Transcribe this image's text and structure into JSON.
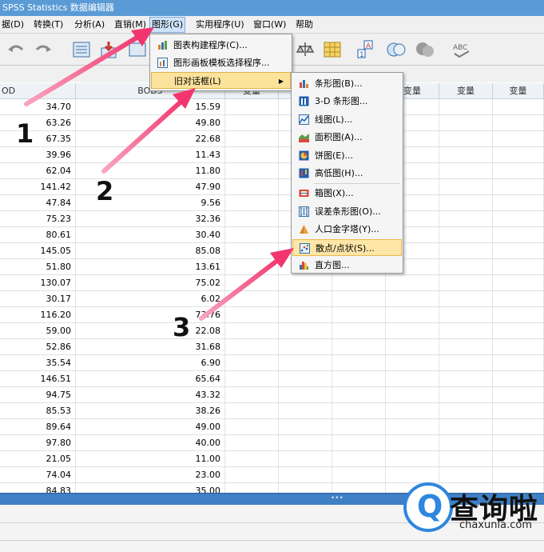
{
  "window": {
    "title": "SPSS Statistics 数据编辑器"
  },
  "menubar": [
    {
      "id": "data",
      "label": "据(D)"
    },
    {
      "id": "transform",
      "label": "转换(T)"
    },
    {
      "id": "analyze",
      "label": "分析(A)"
    },
    {
      "id": "direct",
      "label": "直销(M)"
    },
    {
      "id": "graphs",
      "label": "图形(G)"
    },
    {
      "id": "utilities",
      "label": "实用程序(U)"
    },
    {
      "id": "window",
      "label": "窗口(W)"
    },
    {
      "id": "help",
      "label": "帮助"
    }
  ],
  "grid": {
    "columns": [
      "OD",
      "BOD5",
      "变量",
      "变量",
      "变量",
      "变量",
      "变量",
      "变量"
    ],
    "rows": [
      [
        "34.70",
        "15.59"
      ],
      [
        "63.26",
        "49.80"
      ],
      [
        "67.35",
        "22.68"
      ],
      [
        "39.96",
        "11.43"
      ],
      [
        "62.04",
        "11.80"
      ],
      [
        "141.42",
        "47.90"
      ],
      [
        "47.84",
        "9.56"
      ],
      [
        "75.23",
        "32.36"
      ],
      [
        "80.61",
        "30.40"
      ],
      [
        "145.05",
        "85.08"
      ],
      [
        "51.80",
        "13.61"
      ],
      [
        "130.07",
        "75.02"
      ],
      [
        "30.17",
        "6.02"
      ],
      [
        "116.20",
        "73.76"
      ],
      [
        "59.00",
        "22.08"
      ],
      [
        "52.86",
        "31.68"
      ],
      [
        "35.54",
        "6.90"
      ],
      [
        "146.51",
        "65.64"
      ],
      [
        "94.75",
        "43.32"
      ],
      [
        "85.53",
        "38.26"
      ],
      [
        "89.64",
        "49.00"
      ],
      [
        "97.80",
        "40.00"
      ],
      [
        "21.05",
        "11.00"
      ],
      [
        "74.04",
        "23.00"
      ],
      [
        "84.83",
        "35.00"
      ]
    ]
  },
  "graphs_menu": [
    {
      "label": "图表构建程序(C)...",
      "icon": "chart-builder-icon"
    },
    {
      "label": "图形画板模板选择程序...",
      "icon": "graphboard-icon"
    },
    {
      "label": "旧对话框(L)",
      "icon": "",
      "submenu": true
    }
  ],
  "legacy_submenu": [
    {
      "label": "条形图(B)...",
      "icon": "bar-chart-icon"
    },
    {
      "label": "3-D 条形图...",
      "icon": "3d-bar-icon"
    },
    {
      "label": "线图(L)...",
      "icon": "line-chart-icon"
    },
    {
      "label": "面积图(A)...",
      "icon": "area-chart-icon"
    },
    {
      "label": "饼图(E)...",
      "icon": "pie-chart-icon"
    },
    {
      "label": "高低图(H)...",
      "icon": "high-low-icon"
    },
    {
      "label": "箱图(X)...",
      "icon": "boxplot-icon"
    },
    {
      "label": "误差条形图(O)...",
      "icon": "error-bar-icon"
    },
    {
      "label": "人口金字塔(Y)...",
      "icon": "pyramid-icon"
    },
    {
      "label": "散点/点状(S)...",
      "icon": "scatter-icon"
    },
    {
      "label": "直方图...",
      "icon": "histogram-icon"
    }
  ],
  "annotations": [
    "1",
    "2",
    "3"
  ],
  "watermark": {
    "brand": "查询啦",
    "domain": "chaxunla.com",
    "badge": "Q"
  },
  "colors": {
    "accent": "#5b9bd5",
    "annotation_arrow": "#f2356e",
    "highlight": "#fde6a8"
  }
}
